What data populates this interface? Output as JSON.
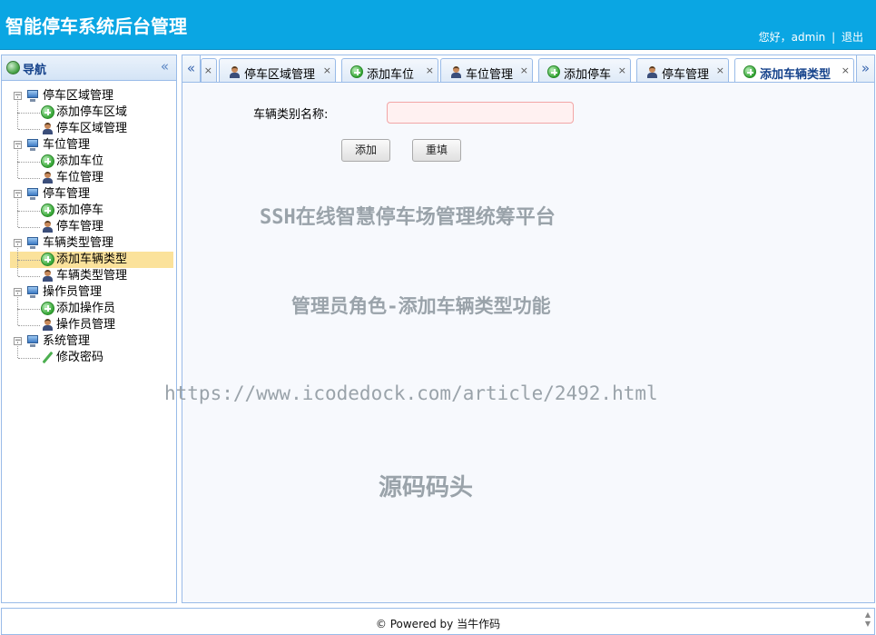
{
  "header": {
    "title": "智能停车系统后台管理",
    "greeting": "您好，admin",
    "separator": "|",
    "logout": "退出"
  },
  "nav": {
    "title": "导航",
    "collapse_glyph": "«",
    "groups": [
      {
        "label": "停车区域管理",
        "items": [
          {
            "label": "添加停车区域",
            "icon": "add-icon"
          },
          {
            "label": "停车区域管理",
            "icon": "person-icon"
          }
        ]
      },
      {
        "label": "车位管理",
        "items": [
          {
            "label": "添加车位",
            "icon": "add-icon"
          },
          {
            "label": "车位管理",
            "icon": "person-icon"
          }
        ]
      },
      {
        "label": "停车管理",
        "items": [
          {
            "label": "添加停车",
            "icon": "add-icon"
          },
          {
            "label": "停车管理",
            "icon": "person-icon"
          }
        ]
      },
      {
        "label": "车辆类型管理",
        "items": [
          {
            "label": "添加车辆类型",
            "icon": "add-icon",
            "selected": true
          },
          {
            "label": "车辆类型管理",
            "icon": "person-icon"
          }
        ]
      },
      {
        "label": "操作员管理",
        "items": [
          {
            "label": "添加操作员",
            "icon": "add-icon"
          },
          {
            "label": "操作员管理",
            "icon": "person-icon"
          }
        ]
      },
      {
        "label": "系统管理",
        "items": [
          {
            "label": "修改密码",
            "icon": "pencil-icon"
          }
        ]
      }
    ]
  },
  "tabs": {
    "scroll_left": "«",
    "scroll_right": "»",
    "close_glyph": "×",
    "items": [
      {
        "label": "",
        "icon": ""
      },
      {
        "label": "停车区域管理",
        "icon": "person-icon"
      },
      {
        "label": "添加车位",
        "icon": "add-icon"
      },
      {
        "label": "车位管理",
        "icon": "person-icon"
      },
      {
        "label": "添加停车",
        "icon": "add-icon"
      },
      {
        "label": "停车管理",
        "icon": "person-icon"
      },
      {
        "label": "添加车辆类型",
        "icon": "add-icon",
        "active": true
      }
    ]
  },
  "form": {
    "field_label": "车辆类别名称:",
    "field_value": "",
    "add_button": "添加",
    "reset_button": "重填"
  },
  "watermarks": {
    "line1": "SSH在线智慧停车场管理统筹平台",
    "line2": "管理员角色-添加车辆类型功能",
    "line3": "https://www.icodedock.com/article/2492.html",
    "line4": "源码码头"
  },
  "footer": {
    "text": "© Powered by 当牛作码"
  },
  "colors": {
    "header_bg": "#0aa6e3",
    "panel_border": "#99bbe8",
    "selected_row": "#fbe29b",
    "input_invalid_bg": "#fff1f1"
  }
}
